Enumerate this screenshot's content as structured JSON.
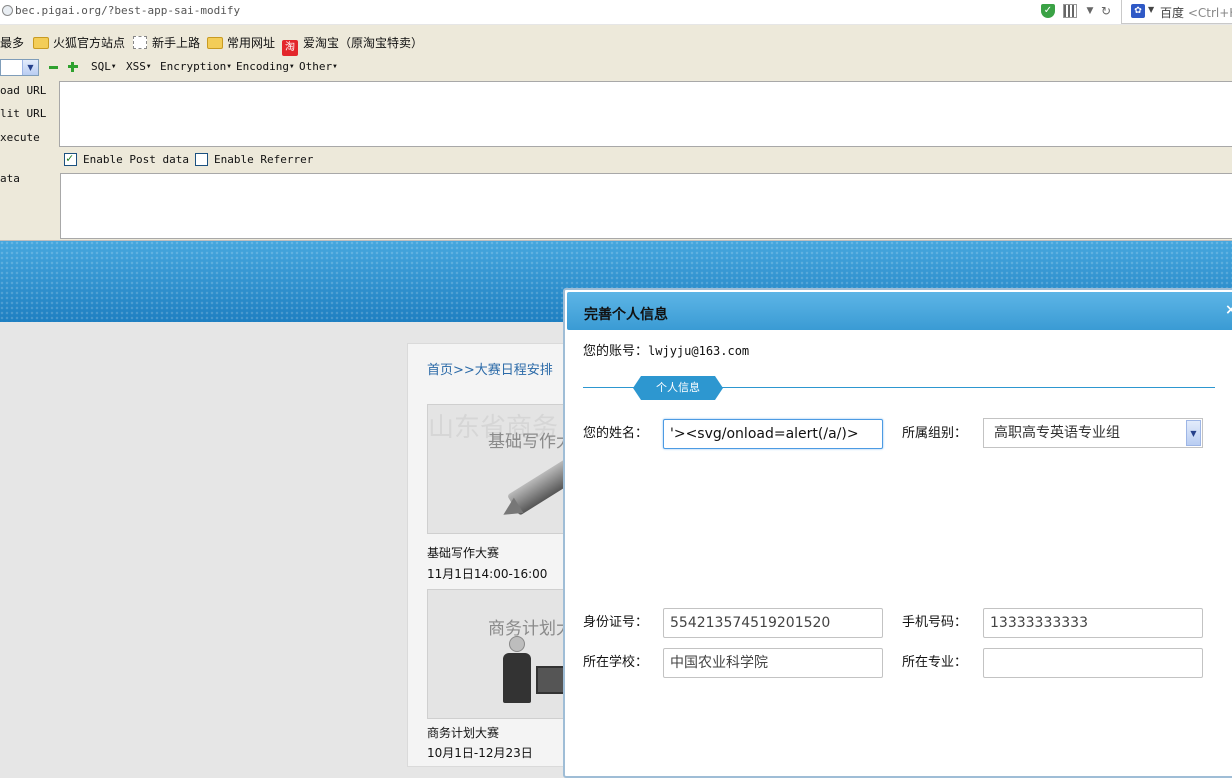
{
  "browser": {
    "url": "bec.pigai.org/?best-app-sai-modify",
    "search_engine": "百度",
    "search_hint": "<Ctrl+K>",
    "icons": [
      "globe-icon",
      "shield-icon",
      "qr-code-icon",
      "dropdown-icon",
      "reload-icon",
      "baidu-paw-icon"
    ]
  },
  "bookmarks": [
    {
      "label": "最多",
      "icon": "none"
    },
    {
      "label": "火狐官方站点",
      "icon": "folder-icon"
    },
    {
      "label": "新手上路",
      "icon": "dashed-page-icon"
    },
    {
      "label": "常用网址",
      "icon": "folder-icon"
    },
    {
      "label": "爱淘宝（原淘宝特卖）",
      "icon": "taobao-icon",
      "icon_text": "淘"
    }
  ],
  "hackbar": {
    "menus": [
      "SQL",
      "XSS",
      "Encryption",
      "Encoding",
      "Other"
    ],
    "side_labels": [
      "oad URL",
      "lit URL",
      "xecute",
      "ata"
    ],
    "enable_post": "Enable Post data",
    "enable_referrer": "Enable Referrer",
    "enable_post_checked": true,
    "enable_referrer_checked": false
  },
  "page": {
    "breadcrumb": "首页>>大赛日程安排",
    "cards": [
      {
        "bg_text": "山东省商务",
        "title": "基础写作大",
        "caption": "基础写作大赛",
        "date": "11月1日14:00-16:00"
      },
      {
        "bg_text": "",
        "title": "商务计划大",
        "caption": "商务计划大赛",
        "date": "10月1日-12月23日"
      }
    ]
  },
  "dialog": {
    "title": "完善个人信息",
    "close": "×",
    "account_label": "您的账号：",
    "account_value": "lwjyju@163.com",
    "section_tab": "个人信息",
    "fields": {
      "name_label": "您的姓名：",
      "name_value": "'><svg/onload=alert(/a/)>",
      "group_label": "所属组别：",
      "group_value": "高职高专英语专业组",
      "id_label": "身份证号：",
      "id_value": "554213574519201520",
      "phone_label": "手机号码：",
      "phone_value": "13333333333",
      "school_label": "所在学校：",
      "school_value": "中国农业科学院",
      "major_label": "所在专业：",
      "major_value": ""
    }
  },
  "colors": {
    "banner": "#2f8fcc",
    "dialog_header": "#4aa8dd",
    "section_accent": "#2d97d0",
    "link": "#2b6aa8"
  }
}
